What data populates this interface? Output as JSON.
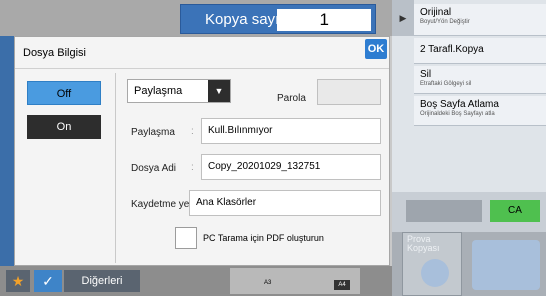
{
  "copy": {
    "label": "Kopya sayısı",
    "value": "1"
  },
  "dialog": {
    "title": "Dosya Bilgisi",
    "ok_label": "OK",
    "toggle": {
      "off_label": "Off",
      "on_label": "On",
      "selected": "Off"
    },
    "mode_select": {
      "value": "Paylaşma"
    },
    "password": {
      "label": "Parola",
      "value": ""
    },
    "fields": [
      {
        "label": "Paylaşma",
        "value": "Kull.Bılınmıyor"
      },
      {
        "label": "Dosya Adi",
        "value": "Copy_20201029_132751"
      },
      {
        "label": "Kaydetme yeri",
        "value": "Ana Klasörler"
      }
    ],
    "pdf_option": {
      "label": "PC Tarama için PDF oluşturun",
      "checked": false
    }
  },
  "right_panel": {
    "items": [
      {
        "title": "Orijinal",
        "subtitle": "Boyut/Yön Değiştir"
      },
      {
        "title": "2 Tarafl.Kopya",
        "subtitle": ""
      },
      {
        "title": "Sil",
        "subtitle": "Etraftaki Gölgeyi sil"
      },
      {
        "title": "Boş Sayfa Atlama",
        "subtitle": "Orijinaldeki Boş Sayfayı atla"
      }
    ],
    "ca_label": "CA",
    "preview_label": "Prova Kopyası"
  },
  "bottom_bar": {
    "others_label": "Diğerleri",
    "thumb_a3": "A3",
    "thumb_a4": "A4"
  },
  "colors": {
    "accent_blue": "#3b73b8",
    "ok_blue": "#2e7dd1",
    "ca_green": "#4fc04f",
    "star_orange": "#f2a12a"
  }
}
